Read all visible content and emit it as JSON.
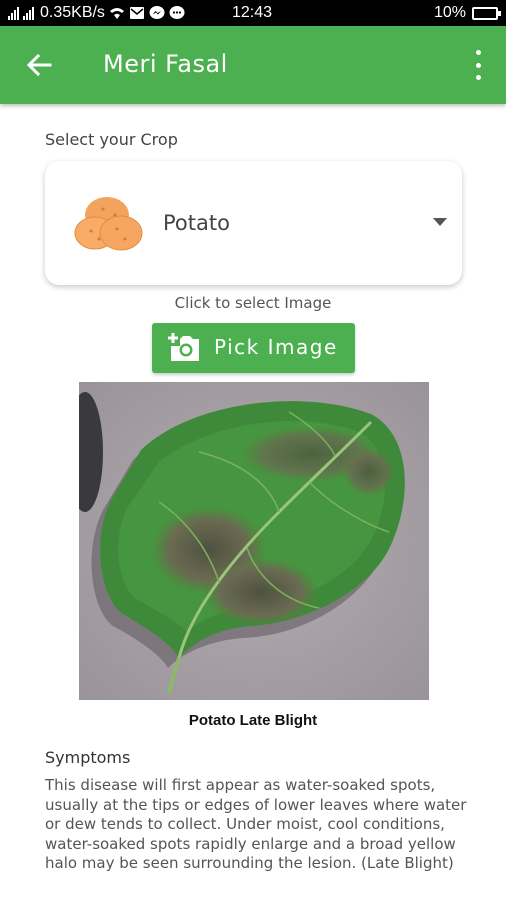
{
  "status_bar": {
    "network_speed": "0.35KB/s",
    "time": "12:43",
    "battery": "10%"
  },
  "app_bar": {
    "title": "Meri Fasal",
    "back_icon": "arrow-left-icon",
    "menu_icon": "more-vertical-icon"
  },
  "crop_selector": {
    "label": "Select your Crop",
    "selected_crop": "Potato",
    "crop_icon": "potato-icon"
  },
  "image_picker": {
    "hint": "Click to select Image",
    "button_label": "Pick Image",
    "button_icon": "add-photo-icon"
  },
  "result": {
    "disease_name": "Potato Late Blight",
    "symptoms_title": "Symptoms",
    "symptoms_text": "This disease will first appear as water-soaked spots, usually at the tips or edges of lower leaves where water or dew tends to collect. Under moist, cool conditions, water-soaked spots rapidly enlarge and a broad yellow halo may be seen surrounding the lesion. (Late Blight)"
  },
  "colors": {
    "primary": "#4caf50",
    "status_bar": "#000000"
  }
}
